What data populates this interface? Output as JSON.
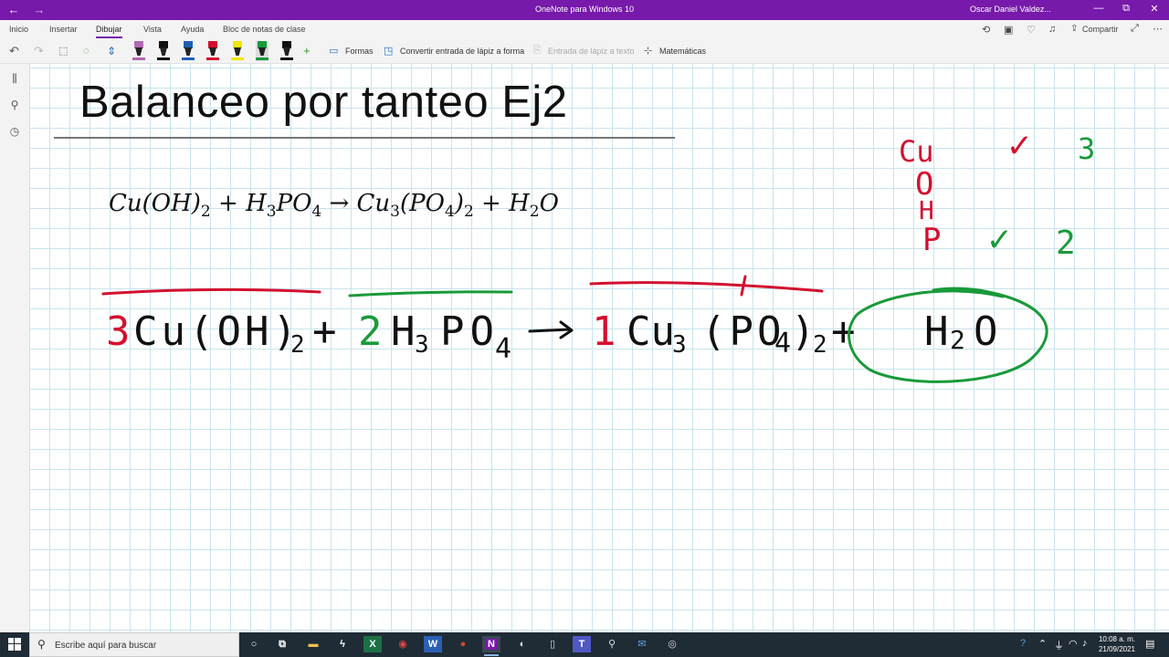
{
  "window": {
    "title": "OneNote para Windows 10",
    "user": "Oscar Daniel Valdez...",
    "controls": {
      "minimize": "—",
      "maximize": "⧉",
      "close": "✕"
    }
  },
  "ribbon": {
    "tabs": [
      {
        "label": "Inicio",
        "active": false
      },
      {
        "label": "Insertar",
        "active": false
      },
      {
        "label": "Dibujar",
        "active": true
      },
      {
        "label": "Vista",
        "active": false
      },
      {
        "label": "Ayuda",
        "active": false
      },
      {
        "label": "Bloc de notas de clase",
        "active": false
      }
    ],
    "share_label": "Compartir"
  },
  "toolbar": {
    "shapes_label": "Formas",
    "ink_to_shape_label": "Convertir entrada de lápiz a forma",
    "ink_to_text_label": "Entrada de lápiz a texto",
    "math_label": "Matemáticas",
    "pens": [
      {
        "name": "pen-pink-highlighter",
        "color": "#b06ab3"
      },
      {
        "name": "pen-black",
        "color": "#111111"
      },
      {
        "name": "pen-blue",
        "color": "#1e5fb5"
      },
      {
        "name": "pen-red",
        "color": "#d3102f"
      },
      {
        "name": "pen-yellow-highlighter",
        "color": "#f2e600"
      },
      {
        "name": "pen-green",
        "color": "#1a9a3a",
        "selected": true
      },
      {
        "name": "pen-black-2",
        "color": "#111111"
      }
    ]
  },
  "page": {
    "title": "Balanceo por tanteo Ej2",
    "equation": {
      "t1": "Cu(OH)",
      "s1": "2",
      "t2": " + H",
      "s2": "3",
      "t3": "PO",
      "s3": "4",
      "t4": " → Cu",
      "s4": "3",
      "t5": "(PO",
      "s5": "4",
      "t6": ")",
      "s6": "2",
      "t7": " + H",
      "s7": "2",
      "t8": "O"
    }
  },
  "ink": {
    "colors": {
      "red": "#d3102f",
      "green": "#1a9a3a",
      "black": "#111111"
    },
    "balanced": {
      "coef1": "3",
      "term1": "Cu(OH)",
      "term1_sub": "2",
      "plus1": "+",
      "coef2": "2",
      "term2a": "H",
      "term2a_sub": "3",
      "term2b": "PO",
      "term2b_sub": "4",
      "arrow": "→",
      "coef3": "1",
      "term3a": "Cu",
      "term3a_sub": "3",
      "term3b": "(PO",
      "term3b_sub": "4",
      "term3c": ")",
      "term3c_sub": "2",
      "plus2": "+",
      "term4a": "H",
      "term4a_sub": "2",
      "term4b": "O"
    },
    "checklist": [
      {
        "element": "Cu",
        "mark": "✓",
        "count": "3"
      },
      {
        "element": "O",
        "mark": "",
        "count": ""
      },
      {
        "element": "H",
        "mark": "",
        "count": ""
      },
      {
        "element": "P",
        "mark": "✓",
        "count": "2"
      }
    ]
  },
  "taskbar": {
    "search_placeholder": "Escribe aquí para buscar",
    "apps": [
      "File Explorer",
      "Excel",
      "Chrome",
      "Word",
      "PowerPoint",
      "OneNote",
      "Teams"
    ],
    "clock_time": "10:08 a. m.",
    "clock_date": "21/09/2021"
  }
}
